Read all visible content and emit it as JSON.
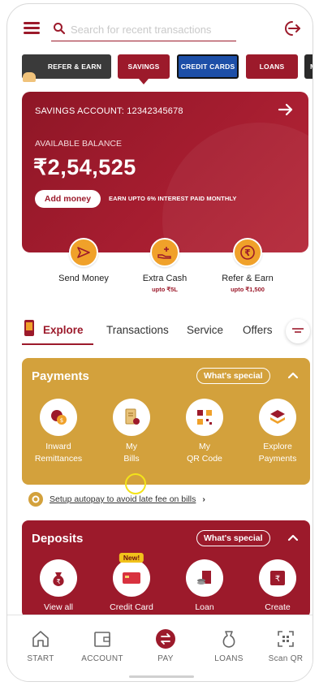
{
  "header": {
    "search_placeholder": "Search for recent transactions"
  },
  "product_tabs": [
    {
      "label": "REFER & EARN"
    },
    {
      "label": "SAVINGS"
    },
    {
      "label": "CREDIT CARDS"
    },
    {
      "label": "LOANS"
    },
    {
      "label": "MU"
    }
  ],
  "account": {
    "title": "SAVINGS ACCOUNT: 12342345678",
    "balance_label": "AVAILABLE BALANCE",
    "balance": "₹2,54,525",
    "add_money": "Add money",
    "interest_note": "EARN UPTO 6% INTEREST PAID MONTHLY"
  },
  "quick_actions": [
    {
      "label": "Send Money",
      "sub": ""
    },
    {
      "label": "Extra Cash",
      "sub": "upto ₹5L"
    },
    {
      "label": "Refer & Earn",
      "sub": "upto ₹1,500"
    }
  ],
  "explore_tabs": [
    {
      "label": "Explore"
    },
    {
      "label": "Transactions"
    },
    {
      "label": "Service"
    },
    {
      "label": "Offers"
    }
  ],
  "payments": {
    "title": "Payments",
    "special": "What's special",
    "tiles": [
      {
        "line1": "Inward",
        "line2": "Remittances"
      },
      {
        "line1": "My",
        "line2": "Bills"
      },
      {
        "line1": "My",
        "line2": "QR Code"
      },
      {
        "line1": "Explore",
        "line2": "Payments"
      }
    ]
  },
  "autopay": {
    "text": "Setup autopay to avoid late fee on bills",
    "chevron": "›"
  },
  "deposits": {
    "title": "Deposits",
    "special": "What's special",
    "new_badge": "New!",
    "tiles": [
      {
        "label": "View all"
      },
      {
        "label": "Credit Card"
      },
      {
        "label": "Loan"
      },
      {
        "label": "Create"
      }
    ]
  },
  "bottom_nav": [
    {
      "label": "START",
      "icon": "home-icon"
    },
    {
      "label": "ACCOUNT",
      "icon": "wallet-icon"
    },
    {
      "label": "PAY",
      "icon": "pay-icon"
    },
    {
      "label": "LOANS",
      "icon": "money-bag-icon"
    },
    {
      "label": "Scan QR",
      "icon": "scan-qr-icon"
    }
  ],
  "colors": {
    "brand": "#9c1a2b",
    "gold": "#d3a13c",
    "accent_orange": "#f0a12a",
    "credit_cards_tab": "#1d4fa8"
  }
}
